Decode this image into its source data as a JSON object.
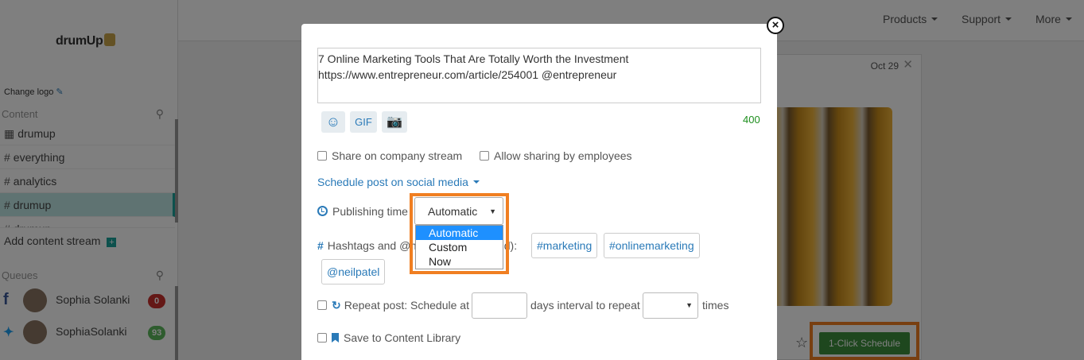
{
  "sidebar": {
    "logo_text": "drumUp",
    "change_logo": "Change logo",
    "content_heading": "Content",
    "streams": [
      {
        "icon": "building-icon",
        "label": "drumup"
      },
      {
        "icon": "hash-icon",
        "label": "everything"
      },
      {
        "icon": "hash-icon",
        "label": "analytics"
      },
      {
        "icon": "hash-icon",
        "label": "drumup"
      },
      {
        "icon": "hash-icon",
        "label": "drumup"
      }
    ],
    "add_stream": "Add content stream",
    "queues_heading": "Queues",
    "queues": [
      {
        "network": "facebook",
        "name": "Sophia Solanki",
        "count": "0",
        "badge_color": "#c9302c"
      },
      {
        "network": "twitter",
        "name": "SophiaSolanki",
        "count": "93",
        "badge_color": "#5cb85c"
      }
    ]
  },
  "topnav": {
    "items": [
      "Products",
      "Support",
      "More"
    ]
  },
  "card": {
    "date": "Oct 29",
    "schedule_button": "1-Click Schedule"
  },
  "modal": {
    "post_text": "7 Online Marketing Tools That Are Totally Worth the Investment\nhttps://www.entrepreneur.com/article/254001 @entrepreneur",
    "gif_label": "GIF",
    "char_count": "400",
    "share_company": "Share on company stream",
    "allow_employees": "Allow sharing by employees",
    "schedule_link": "Schedule post on social media",
    "publishing_time_label": "Publishing time",
    "publishing_time_value": "Automatic",
    "publishing_options": [
      "Automatic",
      "Custom",
      "Now"
    ],
    "hashtags_label_start": "Hashtags and @m",
    "hashtags_label_end": "dd):",
    "tags": [
      "#marketing",
      "#onlinemarketing",
      "@neilpatel"
    ],
    "repeat_label": "Repeat post: Schedule at",
    "days_label": "days interval to repeat",
    "times_label": "times",
    "save_library": "Save to Content Library"
  },
  "colors": {
    "accent": "#2a7ab8",
    "highlight": "#f07f22",
    "dropdown_selected": "#1e90ff",
    "count_green": "#1d8e1d",
    "schedule_green": "#3c8e3c"
  }
}
